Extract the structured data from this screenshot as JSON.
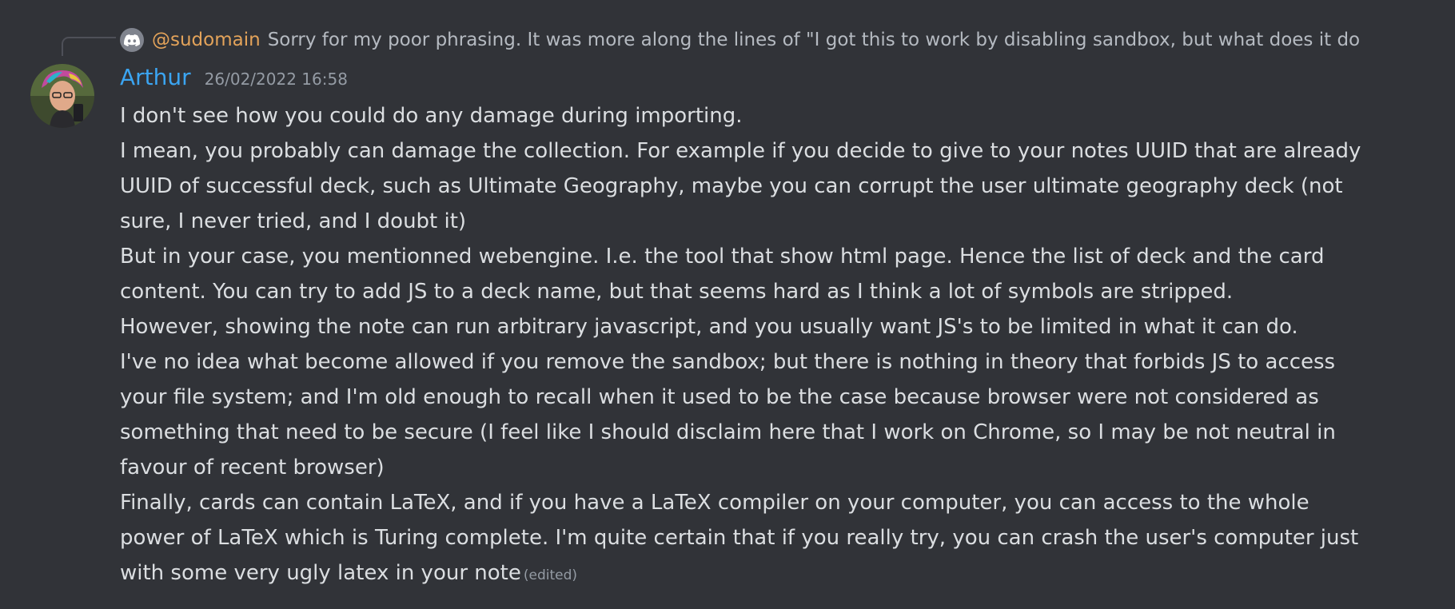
{
  "reply": {
    "author": "@sudomain",
    "text": "Sorry for my poor phrasing. It was more along the lines of \"I got this to work by disabling sandbox, but what does it do"
  },
  "message": {
    "author": "Arthur",
    "author_color": "#3ba5f2",
    "timestamp": "26/02/2022 16:58",
    "lines": [
      "I don't see how you could do any damage during importing.",
      "I mean, you probably can damage the collection. For example if you decide to give to your notes UUID that are already UUID of successful deck, such as Ultimate Geography, maybe you can corrupt the user ultimate geography deck (not sure, I never tried, and I doubt it)",
      "But in your case, you mentionned webengine. I.e. the tool that show html page. Hence the list of deck and the card content. You can try to add JS to a deck name, but that seems hard as I think a lot of symbols are stripped.",
      "However, showing the note can run arbitrary javascript, and you usually want JS's to be limited in what it can do.",
      "I've no idea what become allowed if you remove the sandbox; but there is nothing in theory that forbids JS to access your file system; and I'm old enough to recall when it used to be the case because browser were not considered as something that need to be secure (I feel like I should disclaim here that I work on Chrome, so I may be not neutral in favour of recent browser)",
      "Finally, cards can contain LaTeX, and if you have a LaTeX compiler on your computer, you can access to the whole power of LaTeX which is Turing complete. I'm quite certain that if you really try, you can crash the user's computer just with some very ugly latex in your note"
    ],
    "edited_label": "(edited)"
  }
}
